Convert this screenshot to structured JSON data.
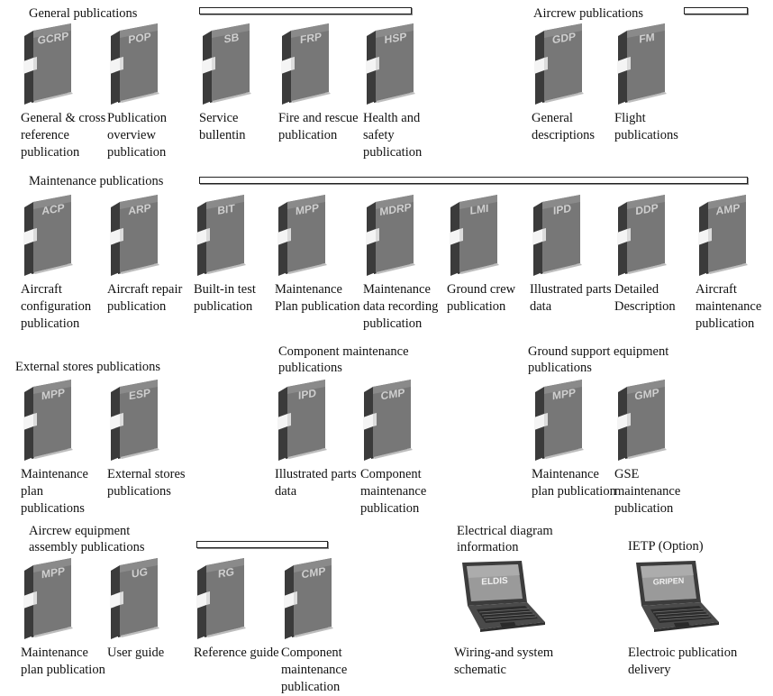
{
  "sections": {
    "general": {
      "title": "General publications",
      "items": [
        {
          "code": "GCRP",
          "label": "General & cross reference publication"
        },
        {
          "code": "POP",
          "label": "Publication overview publication"
        },
        {
          "code": "SB",
          "label": "Service bullentin"
        },
        {
          "code": "FRP",
          "label": "Fire and rescue publication"
        },
        {
          "code": "HSP",
          "label": "Health and safety publication"
        }
      ]
    },
    "aircrew": {
      "title": "Aircrew publications",
      "items": [
        {
          "code": "GDP",
          "label": "General descriptions"
        },
        {
          "code": "FM",
          "label": "Flight publications"
        }
      ]
    },
    "maintenance": {
      "title": "Maintenance publications",
      "items": [
        {
          "code": "ACP",
          "label": "Aircraft configuration publication"
        },
        {
          "code": "ARP",
          "label": "Aircraft repair publication"
        },
        {
          "code": "BIT",
          "label": "Built-in test publication"
        },
        {
          "code": "MPP",
          "label": "Maintenance Plan publication"
        },
        {
          "code": "MDRP",
          "label": "Maintenance data recording publication"
        },
        {
          "code": "LMI",
          "label": "Ground crew publication"
        },
        {
          "code": "IPD",
          "label": "Illustrated parts data"
        },
        {
          "code": "DDP",
          "label": "Detailed Description"
        },
        {
          "code": "AMP",
          "label": "Aircraft maintenance publication"
        }
      ]
    },
    "external": {
      "title": "External stores publications",
      "items": [
        {
          "code": "MPP",
          "label": "Maintenance plan publications"
        },
        {
          "code": "ESP",
          "label": "External stores publications"
        }
      ]
    },
    "component": {
      "title": "Component maintenance publications",
      "items": [
        {
          "code": "IPD",
          "label": "Illustrated parts data"
        },
        {
          "code": "CMP",
          "label": "Component maintenance publication"
        }
      ]
    },
    "gse": {
      "title": "Ground support equipment publications",
      "items": [
        {
          "code": "MPP",
          "label": "Maintenance plan publication"
        },
        {
          "code": "GMP",
          "label": "GSE maintenance publication"
        }
      ]
    },
    "aircrew_equipment": {
      "title": "Aircrew equipment assembly publications",
      "items": [
        {
          "code": "MPP",
          "label": "Maintenance plan publication"
        },
        {
          "code": "UG",
          "label": "User guide"
        },
        {
          "code": "RG",
          "label": "Reference guide"
        },
        {
          "code": "CMP",
          "label": "Component maintenance publication"
        }
      ]
    },
    "electrical": {
      "title": "Electrical diagram information",
      "screen": "ELDIS",
      "label": "Wiring-and system schematic"
    },
    "ietp": {
      "title": "IETP (Option)",
      "screen": "GRIPEN",
      "label": "Electroic publication delivery"
    }
  },
  "colors": {
    "book_cover": "#6f6f6f",
    "book_spine": "#3a3a3a",
    "book_band": "#f2f2f2",
    "laptop_body": "#4a4a4a"
  }
}
